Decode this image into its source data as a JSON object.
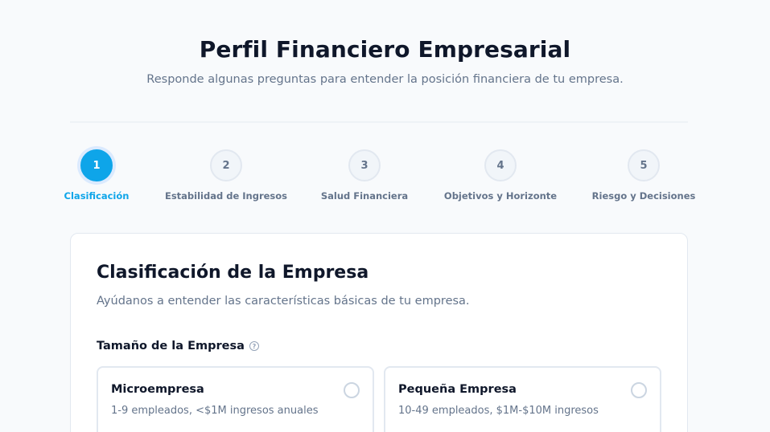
{
  "header": {
    "title": "Perfil Financiero Empresarial",
    "subtitle": "Responde algunas preguntas para entender la posición financiera de tu empresa."
  },
  "steps": [
    {
      "number": "1",
      "label": "Clasificación",
      "active": true
    },
    {
      "number": "2",
      "label": "Estabilidad de Ingresos",
      "active": false
    },
    {
      "number": "3",
      "label": "Salud Financiera",
      "active": false
    },
    {
      "number": "4",
      "label": "Objetivos y Horizonte",
      "active": false
    },
    {
      "number": "5",
      "label": "Riesgo y Decisiones",
      "active": false
    }
  ],
  "card": {
    "title": "Clasificación de la Empresa",
    "subtitle": "Ayúdanos a entender las características básicas de tu empresa.",
    "field_label": "Tamaño de la Empresa",
    "help_icon": "?",
    "options": [
      {
        "title": "Microempresa",
        "description": "1-9 empleados, <$1M ingresos anuales",
        "selected": false
      },
      {
        "title": "Pequeña Empresa",
        "description": "10-49 empleados, $1M-$10M ingresos",
        "selected": false
      }
    ]
  },
  "colors": {
    "accent": "#0ea5e9",
    "text": "#0f172a",
    "muted": "#64748b",
    "border": "#e2e8f0"
  }
}
